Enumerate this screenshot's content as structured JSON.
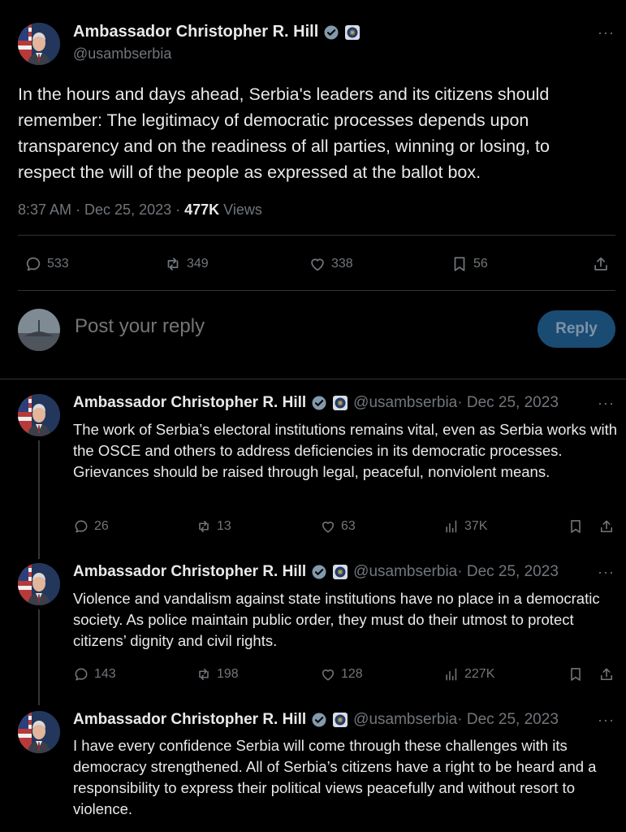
{
  "main_tweet": {
    "author": "Ambassador Christopher R. Hill",
    "handle": "@usambserbia",
    "text": "In the hours and days ahead, Serbia's leaders and its citizens should remember: The legitimacy of democratic processes depends upon transparency and on the readiness of all parties, winning or losing, to respect the will of the people as expressed at the ballot box.",
    "time": "8:37 AM · Dec 25, 2023 · ",
    "views_count": "477K",
    "views_label": " Views",
    "replies": "533",
    "reposts": "349",
    "likes": "338",
    "bookmarks": "56"
  },
  "reply_box": {
    "placeholder": "Post your reply",
    "button_label": "Reply"
  },
  "thread": [
    {
      "author": "Ambassador Christopher R. Hill",
      "handle": "@usambserbia",
      "date": " · Dec 25, 2023",
      "text": "The work of Serbia’s electoral institutions remains vital, even as Serbia works with the OSCE and others to address deficiencies in its democratic processes. Grievances should be raised through legal, peaceful, nonviolent means.",
      "replies": "26",
      "reposts": "13",
      "likes": "63",
      "views": "37K"
    },
    {
      "author": "Ambassador Christopher R. Hill",
      "handle": "@usambserbia",
      "date": " · Dec 25, 2023",
      "text": "Violence and vandalism against state institutions have no place in a democratic society. As police maintain public order, they must do their utmost to protect citizens’ dignity and civil rights.",
      "replies": "143",
      "reposts": "198",
      "likes": "128",
      "views": "227K"
    },
    {
      "author": "Ambassador Christopher R. Hill",
      "handle": "@usambserbia",
      "date": " · Dec 25, 2023",
      "text": "I have every confidence Serbia will come through these challenges with its democracy strengthened. All of Serbia’s citizens have a right to be heard and a responsibility to express their political views peacefully and without resort to violence."
    }
  ],
  "colors": {
    "background": "#000000",
    "text": "#e7e9ea",
    "muted": "#71767b",
    "divider": "#2f3336",
    "reply_button_bg": "#1a4b73",
    "verified_badge": "#829aab"
  },
  "icons": [
    "verified-badge-icon",
    "us-government-seal-icon",
    "more-options-icon",
    "reply-icon",
    "repost-icon",
    "like-icon",
    "bookmark-icon",
    "share-icon",
    "views-icon"
  ]
}
